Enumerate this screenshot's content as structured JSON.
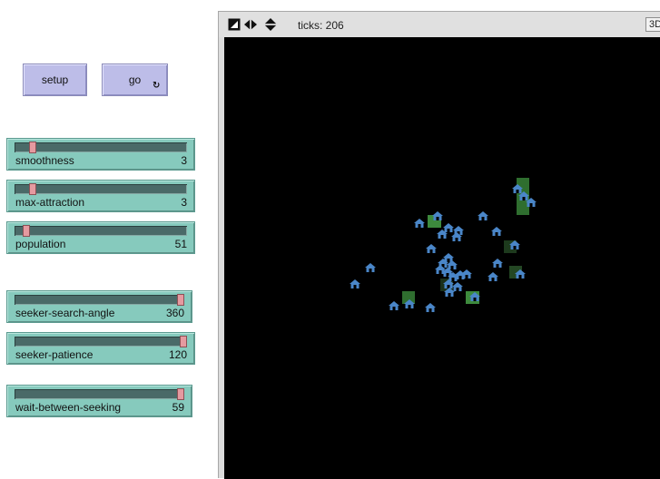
{
  "buttons": {
    "setup": "setup",
    "go": "go",
    "go_forever_icon": "forever-loop-icon"
  },
  "sliders": [
    {
      "name": "smoothness",
      "value": "3",
      "fraction": 0.09
    },
    {
      "name": "max-attraction",
      "value": "3",
      "fraction": 0.09
    },
    {
      "name": "population",
      "value": "51",
      "fraction": 0.05
    },
    {
      "name": "seeker-search-angle",
      "value": "360",
      "fraction": 1.0
    },
    {
      "name": "seeker-patience",
      "value": "120",
      "fraction": 1.0
    },
    {
      "name": "wait-between-seeking",
      "value": "59",
      "fraction": 1.0
    }
  ],
  "view": {
    "ticks_label": "ticks: 206",
    "threed_label": "3D",
    "toolbar_icons": [
      "edit-icon",
      "arrows-horizontal-icon",
      "arrows-vertical-icon"
    ],
    "background": "#000000",
    "house_color": "#4a86c8"
  }
}
